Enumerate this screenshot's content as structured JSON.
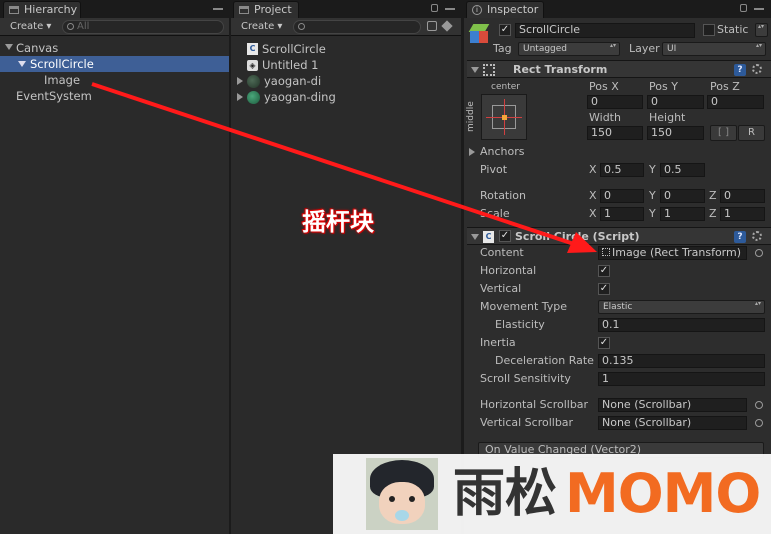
{
  "hierarchy": {
    "tab_label": "Hierarchy",
    "create_label": "Create",
    "search_placeholder": "All",
    "items": [
      "Canvas",
      "ScrollCircle",
      "Image",
      "EventSystem"
    ]
  },
  "project": {
    "tab_label": "Project",
    "create_label": "Create",
    "items": [
      "ScrollCircle",
      "Untitled 1",
      "yaogan-di",
      "yaogan-ding"
    ]
  },
  "inspector": {
    "tab_label": "Inspector",
    "object_name": "ScrollCircle",
    "static_label": "Static",
    "tag_label": "Tag",
    "tag_value": "Untagged",
    "layer_label": "Layer",
    "layer_value": "UI",
    "rect_transform": {
      "title": "Rect Transform",
      "anchor_h": "center",
      "anchor_v": "middle",
      "pos_x_label": "Pos X",
      "pos_y_label": "Pos Y",
      "pos_z_label": "Pos Z",
      "pos_x": "0",
      "pos_y": "0",
      "pos_z": "0",
      "width_label": "Width",
      "height_label": "Height",
      "width": "150",
      "height": "150",
      "raw_btn": "R",
      "anchors_label": "Anchors",
      "pivot_label": "Pivot",
      "pivot_x": "0.5",
      "pivot_y": "0.5",
      "rotation_label": "Rotation",
      "rot_x": "0",
      "rot_y": "0",
      "rot_z": "0",
      "scale_label": "Scale",
      "scale_x": "1",
      "scale_y": "1",
      "scale_z": "1",
      "x": "X",
      "y": "Y",
      "z": "Z"
    },
    "scroll_circle": {
      "title": "Scroll Circle (Script)",
      "content_label": "Content",
      "content_value": "Image (Rect Transform)",
      "horizontal_label": "Horizontal",
      "vertical_label": "Vertical",
      "movement_type_label": "Movement Type",
      "movement_type_value": "Elastic",
      "elasticity_label": "Elasticity",
      "elasticity_value": "0.1",
      "inertia_label": "Inertia",
      "deceleration_label": "Deceleration Rate",
      "deceleration_value": "0.135",
      "scroll_sensitivity_label": "Scroll Sensitivity",
      "scroll_sensitivity_value": "1",
      "h_scrollbar_label": "Horizontal Scrollbar",
      "h_scrollbar_value": "None (Scrollbar)",
      "v_scrollbar_label": "Vertical Scrollbar",
      "v_scrollbar_value": "None (Scrollbar)",
      "on_value_changed": "On Value Changed (Vector2)"
    }
  },
  "annotation": {
    "text": "摇杆块",
    "arrow_color": "#ff1a1a"
  },
  "watermark": {
    "text_cn": "雨松",
    "text_en": "MOMO",
    "accent": "#f26b21"
  }
}
